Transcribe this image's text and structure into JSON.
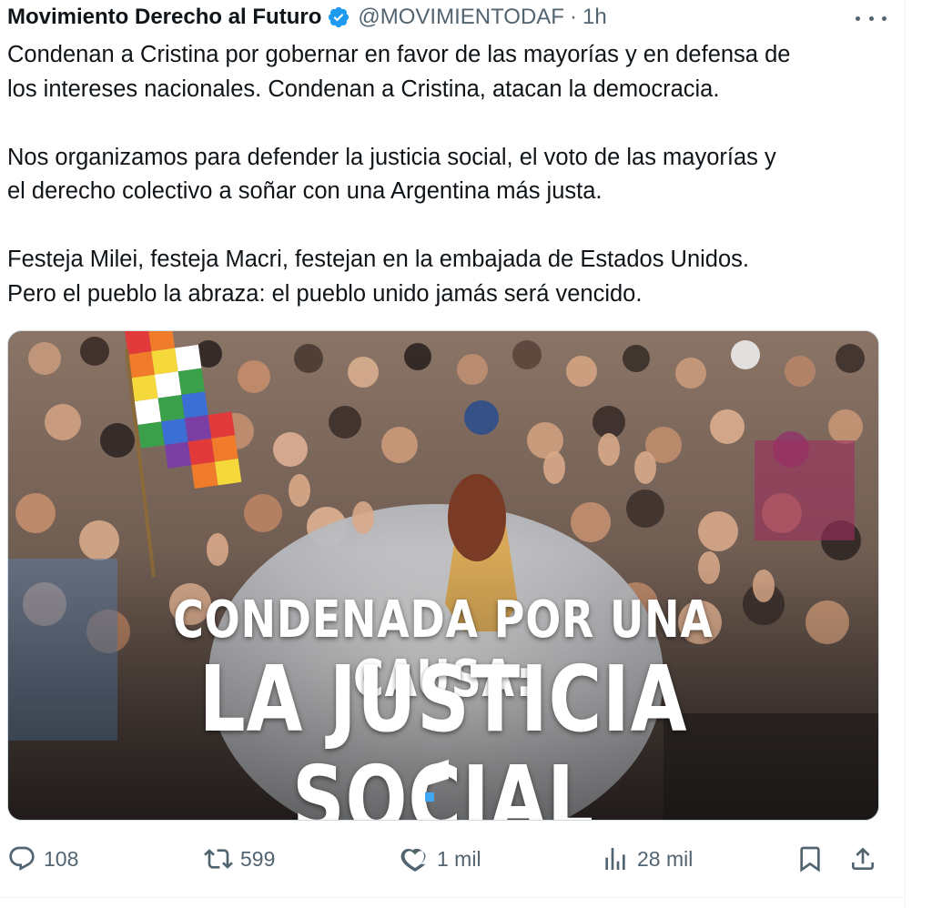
{
  "tweet": {
    "author_name": "Movimiento Derecho al Futuro",
    "handle": "@MOVIMIENTODAF",
    "separator": "·",
    "time": "1h",
    "verified": true,
    "lines": [
      "Condenan a Cristina por gobernar en favor de las mayorías y en defensa de",
      "los intereses nacionales. Condenan a Cristina, atacan la democracia.",
      "",
      "Nos organizamos para defender la justicia social, el voto de las mayorías y",
      "el derecho colectivo a soñar con una Argentina más justa.",
      "",
      "Festeja Milei, festeja Macri, festejan en la embajada de Estados Unidos.",
      "Pero el pueblo la abraza: el pueblo unido jamás será vencido."
    ],
    "image": {
      "banner_line_1": "CONDENADA POR UNA CAUSA:",
      "banner_line_2": "LA JUSTICIA SOCIAL"
    }
  },
  "actions": {
    "reply": {
      "icon": "reply-icon",
      "count": "108"
    },
    "retweet": {
      "icon": "retweet-icon",
      "count": "599"
    },
    "like": {
      "icon": "heart-icon",
      "count": "1 mil"
    },
    "views": {
      "icon": "views-icon",
      "count": "28 mil"
    },
    "bookmark": {
      "icon": "bookmark-icon"
    },
    "share": {
      "icon": "share-icon"
    }
  },
  "colors": {
    "text_primary": "#0f1419",
    "text_secondary": "#536471",
    "verified_blue": "#1d9bf0",
    "border": "#cfd9de",
    "logo_blue": "#3fa9f5"
  }
}
